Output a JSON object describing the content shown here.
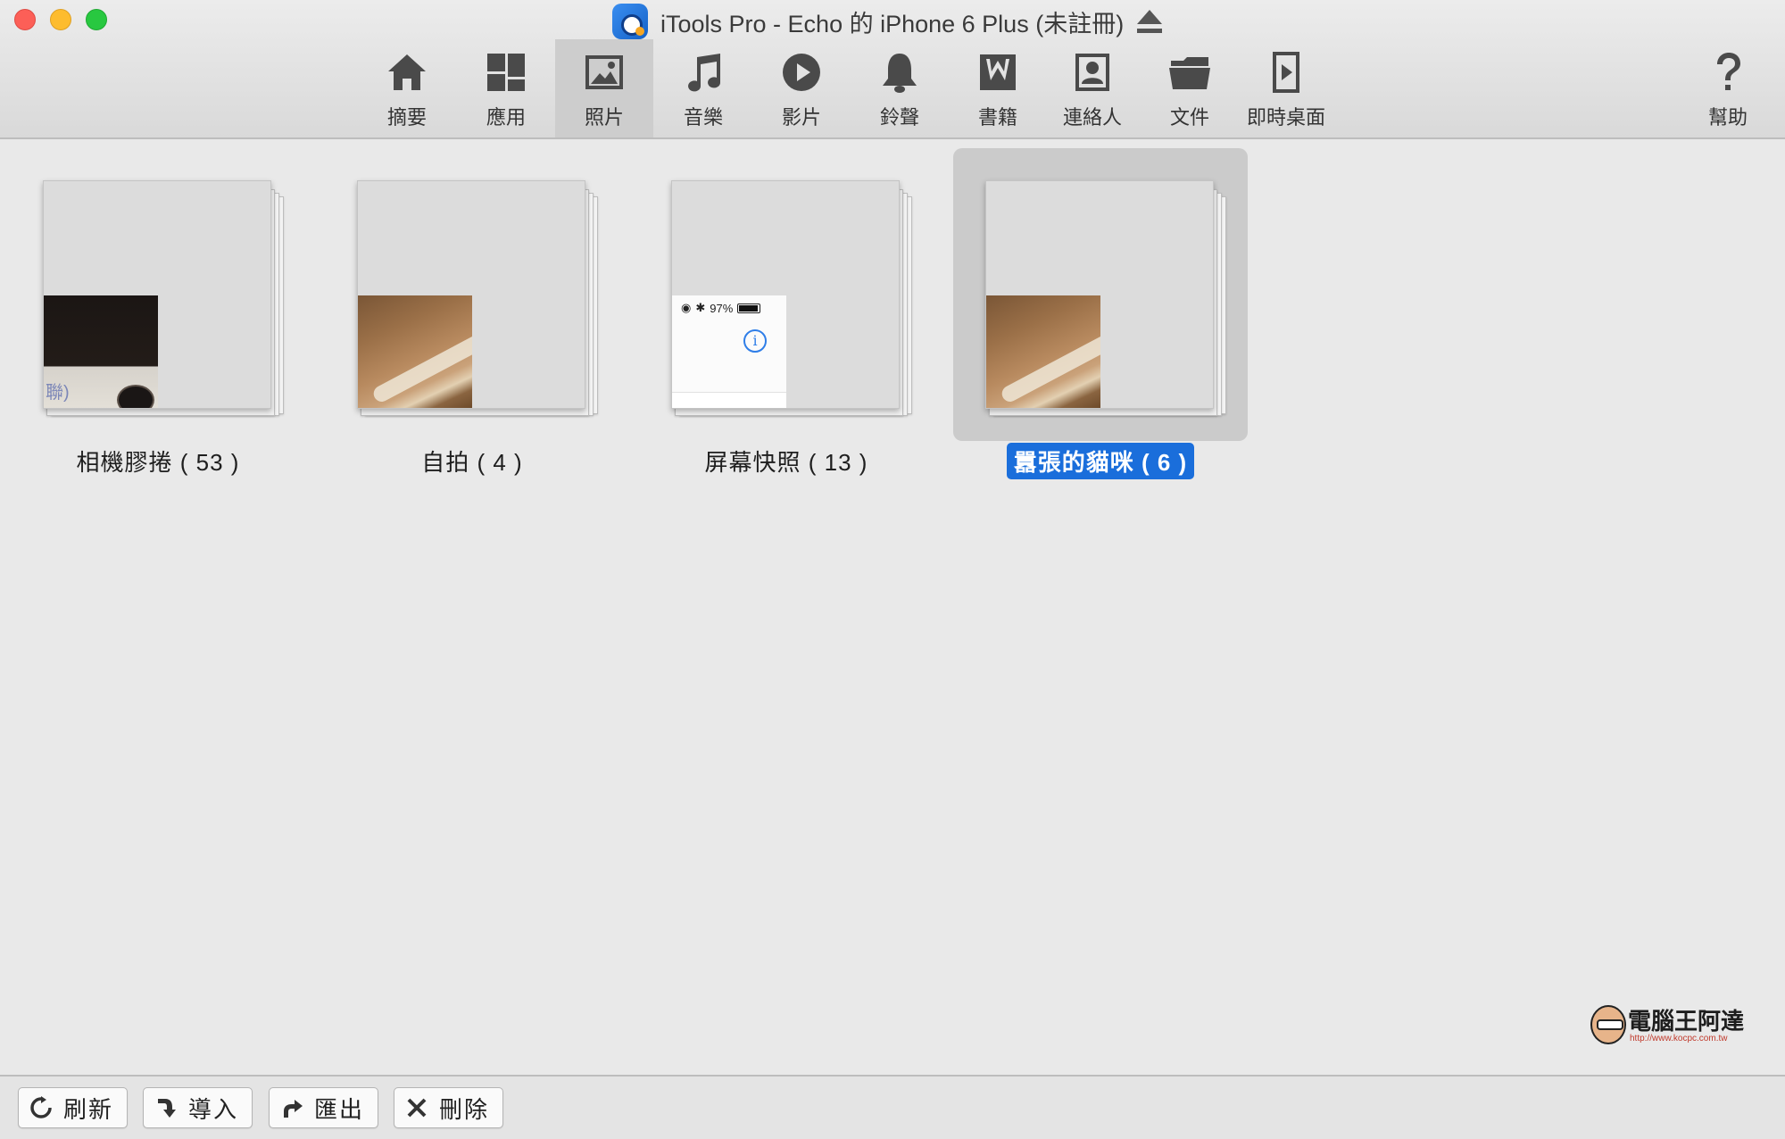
{
  "window": {
    "title": "iTools Pro - Echo 的 iPhone 6 Plus (未註冊)"
  },
  "toolbar": {
    "items": [
      {
        "label": "摘要",
        "icon": "home-icon"
      },
      {
        "label": "應用",
        "icon": "apps-icon"
      },
      {
        "label": "照片",
        "icon": "photo-icon",
        "active": true
      },
      {
        "label": "音樂",
        "icon": "music-icon"
      },
      {
        "label": "影片",
        "icon": "video-icon"
      },
      {
        "label": "鈴聲",
        "icon": "bell-icon"
      },
      {
        "label": "書籍",
        "icon": "book-icon"
      },
      {
        "label": "連絡人",
        "icon": "contacts-icon"
      },
      {
        "label": "文件",
        "icon": "folder-icon"
      },
      {
        "label": "即時桌面",
        "icon": "live-wallpaper-icon"
      }
    ],
    "help": {
      "label": "幫助",
      "icon": "help-icon"
    }
  },
  "albums": [
    {
      "label": "相機膠捲 ( 53 )",
      "selected": false
    },
    {
      "label": "自拍 ( 4 )",
      "selected": false
    },
    {
      "label": "屏幕快照 ( 13 )",
      "selected": false,
      "status_battery": "97%"
    },
    {
      "label": "囂張的貓咪 ( 6 )",
      "selected": true
    }
  ],
  "thumb_texts": {
    "camera_roll_caption": "聯)"
  },
  "watermark": {
    "text": "電腦王阿達",
    "url": "http://www.kocpc.com.tw"
  },
  "bottom": {
    "buttons": [
      {
        "label": "刷新",
        "icon": "refresh-icon"
      },
      {
        "label": "導入",
        "icon": "import-icon"
      },
      {
        "label": "匯出",
        "icon": "export-icon"
      },
      {
        "label": "刪除",
        "icon": "delete-icon"
      }
    ]
  },
  "colors": {
    "selection": "#1a6edb",
    "background": "#e9e9e9",
    "close": "#fc5f57",
    "minimize": "#fdbc2e",
    "maximize": "#28c840"
  }
}
